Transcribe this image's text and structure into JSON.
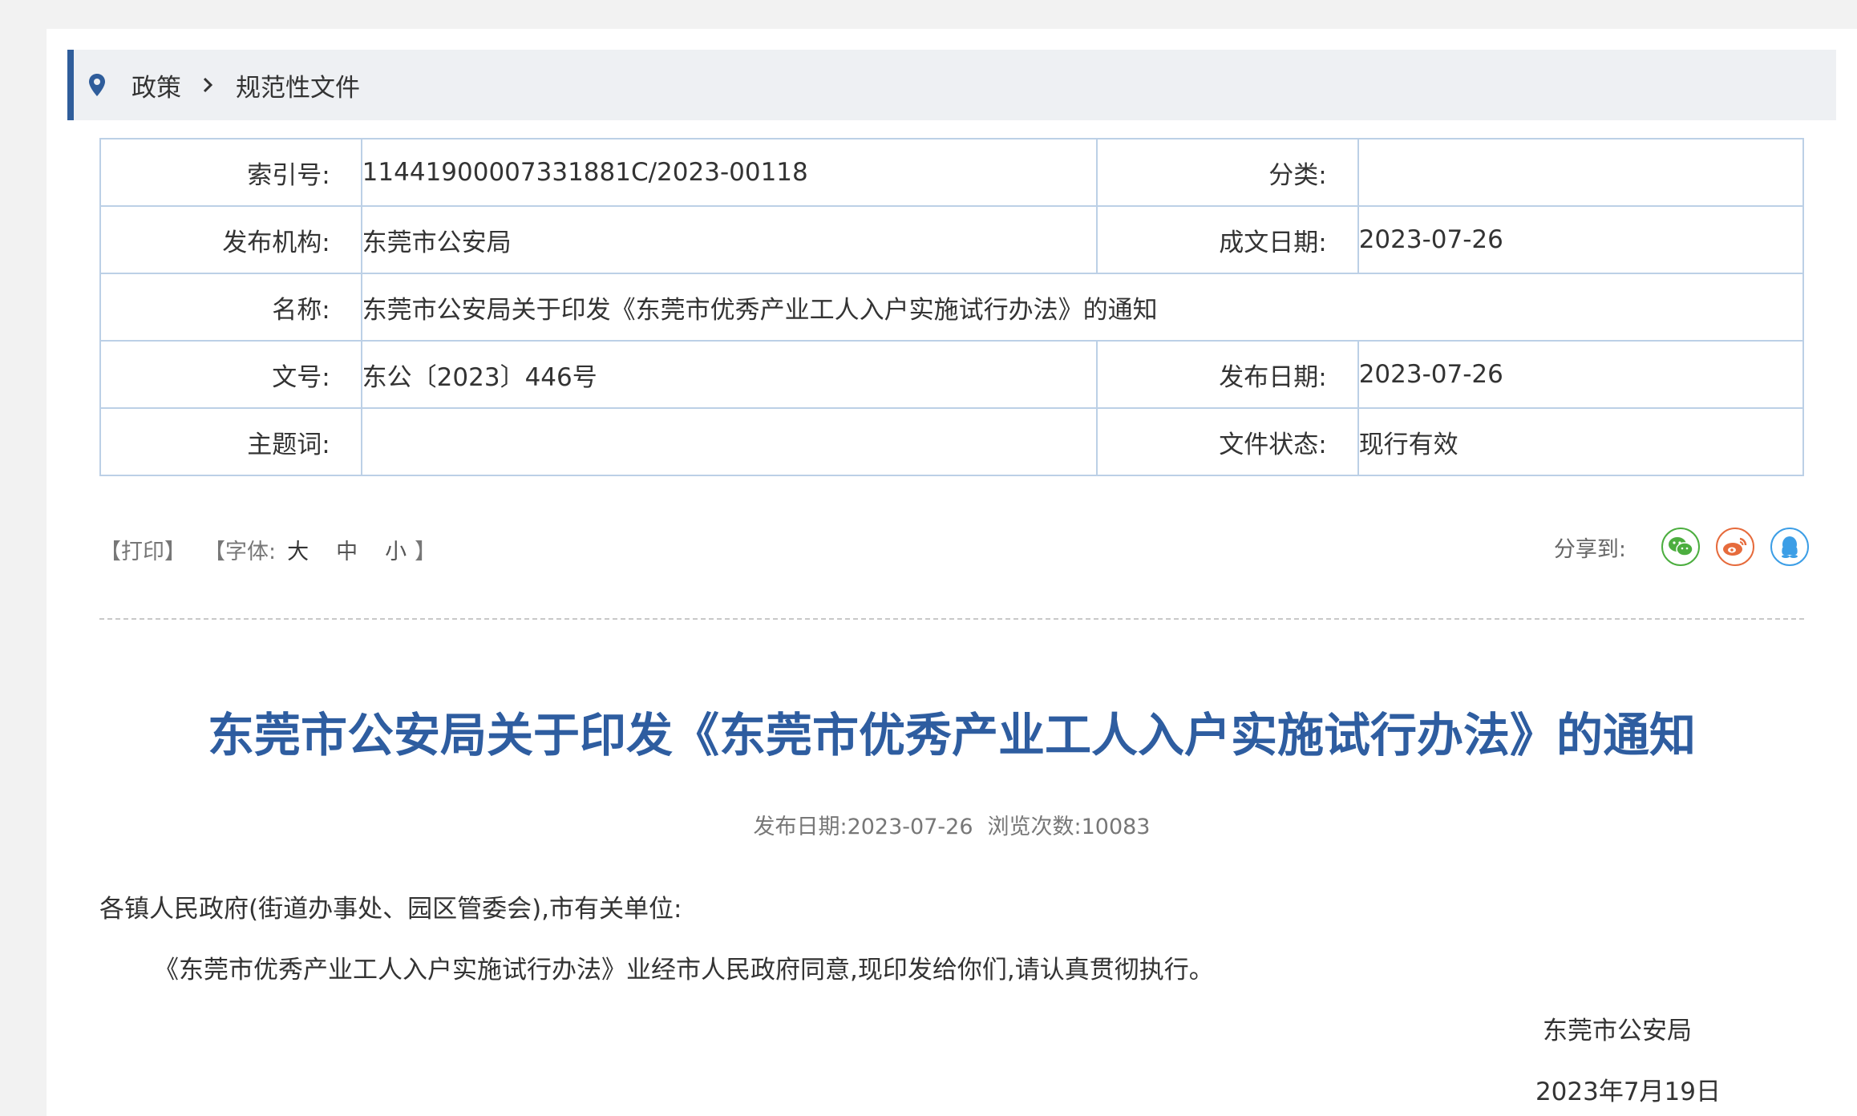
{
  "breadcrumb": {
    "items": [
      "政策",
      "规范性文件"
    ]
  },
  "meta": {
    "index_label": "索引号:",
    "index_value": "11441900007331881C/2023-00118",
    "category_label": "分类:",
    "category_value": "",
    "issuer_label": "发布机构:",
    "issuer_value": "东莞市公安局",
    "written_label": "成文日期:",
    "written_value": "2023-07-26",
    "name_label": "名称:",
    "name_value": "东莞市公安局关于印发《东莞市优秀产业工人入户实施试行办法》的通知",
    "docno_label": "文号:",
    "docno_value": "东公〔2023〕446号",
    "pubdate_label": "发布日期:",
    "pubdate_value": "2023-07-26",
    "keywords_label": "主题词:",
    "keywords_value": "",
    "status_label": "文件状态:",
    "status_value": "现行有效"
  },
  "tools": {
    "print": "【打印】",
    "font_open": "【字体:",
    "large": "大",
    "medium": "中",
    "small": "小",
    "font_close": "】"
  },
  "share": {
    "label": "分享到:",
    "icons": [
      "wechat-icon",
      "weibo-icon",
      "qq-icon"
    ]
  },
  "article": {
    "title": "东莞市公安局关于印发《东莞市优秀产业工人入户实施试行办法》的通知",
    "pub_date": "发布日期:2023-07-26",
    "views": "浏览次数:10083",
    "salutation": "各镇人民政府(街道办事处、园区管委会),市有关单位:",
    "paragraph": "《东莞市优秀产业工人入户实施试行办法》业经市人民政府同意,现印发给你们,请认真贯彻执行。",
    "signature": "东莞市公安局",
    "sign_date": "2023年7月19日"
  },
  "colors": {
    "accent": "#2f5d9b",
    "title": "#2e5da0",
    "table_border": "#bcd0e6",
    "wechat": "#4cae3f",
    "weibo": "#e66b3c",
    "qq": "#3c9ee6"
  }
}
